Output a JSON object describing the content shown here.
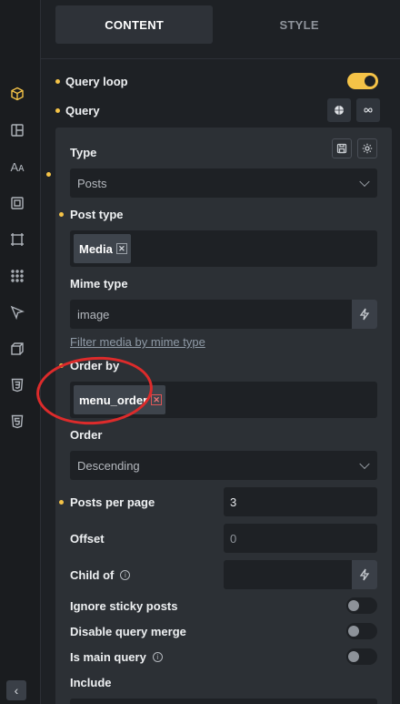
{
  "tabs": {
    "content": "CONTENT",
    "style": "STYLE"
  },
  "controls": {
    "query_loop": "Query loop",
    "query": "Query"
  },
  "query_panel": {
    "type": {
      "label": "Type",
      "value": "Posts"
    },
    "post_type": {
      "label": "Post type",
      "tags": [
        "Media"
      ]
    },
    "mime_type": {
      "label": "Mime type",
      "value": "image",
      "link": "Filter media by mime type"
    },
    "order_by": {
      "label": "Order by",
      "tags": [
        "menu_order"
      ]
    },
    "order": {
      "label": "Order",
      "value": "Descending"
    },
    "posts_per_page": {
      "label": "Posts per page",
      "value": "3"
    },
    "offset": {
      "label": "Offset",
      "placeholder": "0"
    },
    "child_of": {
      "label": "Child of",
      "value": ""
    },
    "ignore_sticky": {
      "label": "Ignore sticky posts",
      "on": false
    },
    "disable_merge": {
      "label": "Disable query merge",
      "on": false
    },
    "is_main_query": {
      "label": "Is main query",
      "on": false
    },
    "include": {
      "label": "Include"
    }
  },
  "icons": {
    "sidebar": [
      "box-icon",
      "layout-icon",
      "typography-icon",
      "spacing-icon",
      "frame-icon",
      "grid-icon",
      "cursor-icon",
      "transform-3d-icon",
      "css3-icon",
      "html5-icon"
    ]
  },
  "colors": {
    "accent": "#f5c347",
    "annotation": "#dd2b2b"
  }
}
